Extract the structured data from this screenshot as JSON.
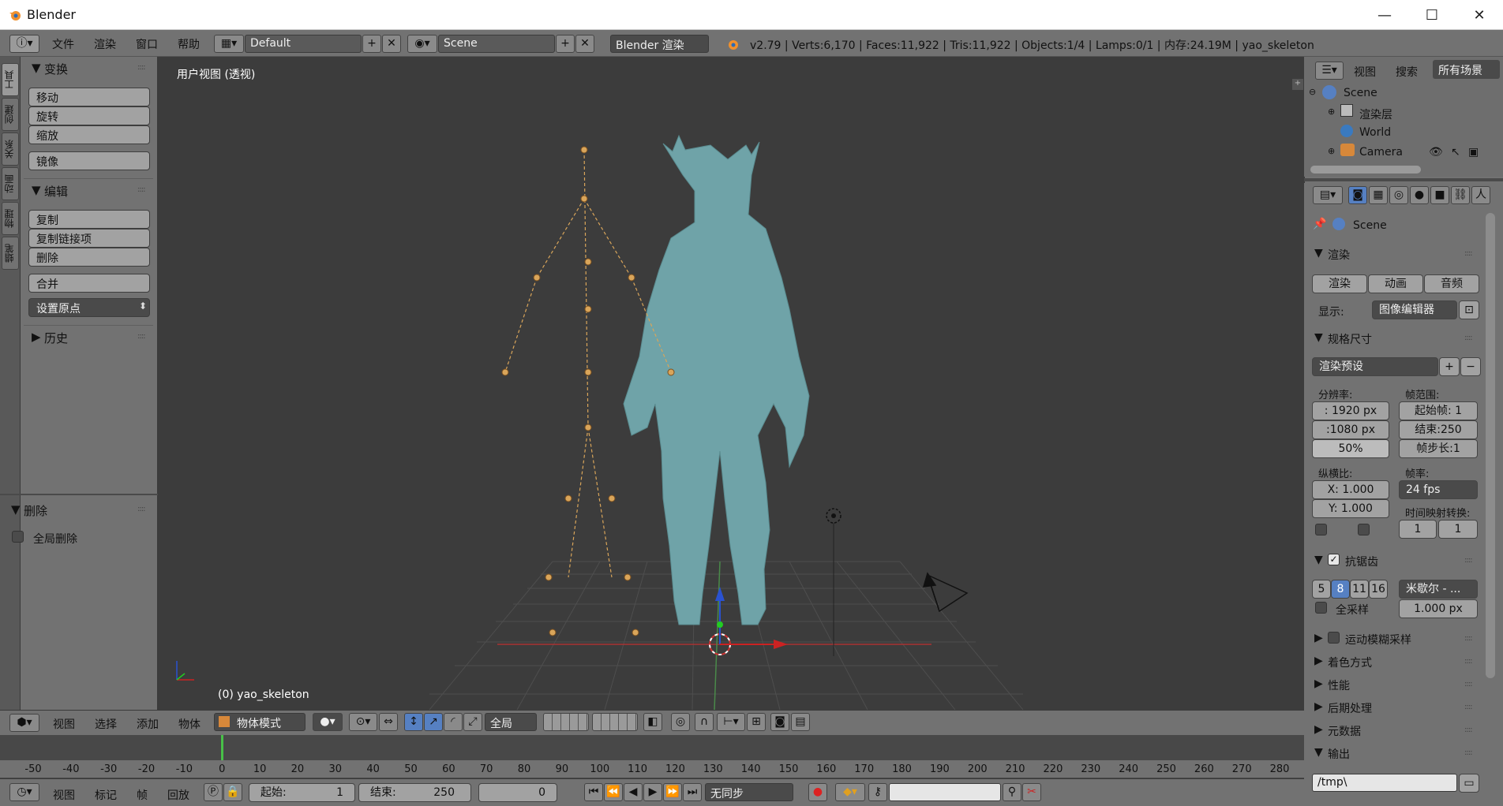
{
  "window": {
    "title": "Blender",
    "minimize": "—",
    "maximize": "☐",
    "close": "✕"
  },
  "menu": [
    "文件",
    "渲染",
    "窗口",
    "帮助"
  ],
  "layout": {
    "name": "Default"
  },
  "scene": {
    "name": "Scene"
  },
  "engine": "Blender 渲染",
  "stats": "v2.79 | Verts:6,170 | Faces:11,922 | Tris:11,922 | Objects:1/4 | Lamps:0/1 | 内存:24.19M | yao_skeleton",
  "left_tabs": [
    "工具",
    "创建",
    "关系",
    "动画",
    "物理",
    "蜡笔"
  ],
  "toolshelf": {
    "transform": {
      "title": "变换",
      "buttons": [
        "移动",
        "旋转",
        "缩放"
      ],
      "mirror": "镜像"
    },
    "edit": {
      "title": "编辑",
      "buttons": [
        "复制",
        "复制链接项",
        "删除"
      ],
      "join": "合并",
      "origin": "设置原点"
    },
    "history": {
      "title": "历史"
    },
    "operator": {
      "title": "删除",
      "option": "全局删除"
    }
  },
  "viewport": {
    "label": "用户视图 (透视)",
    "object": "(0) yao_skeleton"
  },
  "outliner": {
    "tabs": [
      "视图",
      "搜索",
      "所有场景"
    ],
    "items": [
      "Scene",
      "渲染层",
      "World",
      "Camera"
    ]
  },
  "properties": {
    "context": "Scene",
    "render": {
      "title": "渲染",
      "buttons": [
        "渲染",
        "动画",
        "音频"
      ],
      "display_label": "显示:",
      "display_value": "图像编辑器"
    },
    "dimensions": {
      "title": "规格尺寸",
      "preset": "渲染预设",
      "resolution_label": "分辨率:",
      "res_x": ": 1920 px",
      "res_y": ":1080 px",
      "res_pct": "50%",
      "frame_range_label": "帧范围:",
      "start": "起始帧: 1",
      "end": "结束:250",
      "step": "帧步长:1",
      "aspect_label": "纵横比:",
      "aspect_x": "X:  1.000",
      "aspect_y": "Y:  1.000",
      "fps_label": "帧率:",
      "fps": "24 fps",
      "remap_label": "时间映射转换:",
      "remap_old": "1",
      "remap_new": "1"
    },
    "antialias": {
      "title": "抗锯齿",
      "samples": [
        "5",
        "8",
        "11",
        "16"
      ],
      "selected": "8",
      "filter": "米歇尔 - ...",
      "full_sample": "全采样",
      "size": "1.000 px"
    },
    "collapsed": [
      "运动模糊采样",
      "着色方式",
      "性能",
      "后期处理",
      "元数据"
    ],
    "output": {
      "title": "输出",
      "path": "/tmp\\"
    }
  },
  "view3d_header": {
    "menus": [
      "视图",
      "选择",
      "添加",
      "物体"
    ],
    "mode": "物体模式",
    "orientation": "全局"
  },
  "timeline": {
    "ticks": [
      "-50",
      "-40",
      "-30",
      "-20",
      "-10",
      "0",
      "10",
      "20",
      "30",
      "40",
      "50",
      "60",
      "70",
      "80",
      "90",
      "100",
      "110",
      "120",
      "130",
      "140",
      "150",
      "160",
      "170",
      "180",
      "190",
      "200",
      "210",
      "220",
      "230",
      "240",
      "250",
      "260",
      "270",
      "280"
    ],
    "current_frame": 0
  },
  "timeline_header": {
    "menus": [
      "视图",
      "标记",
      "帧",
      "回放"
    ],
    "start": "起始:",
    "start_val": "1",
    "end": "结束:",
    "end_val": "250",
    "current": "0",
    "sync": "无同步"
  },
  "colors": {
    "accent": "#5680c2",
    "model": "#6fa3a8",
    "bone": "#d9a55a"
  }
}
